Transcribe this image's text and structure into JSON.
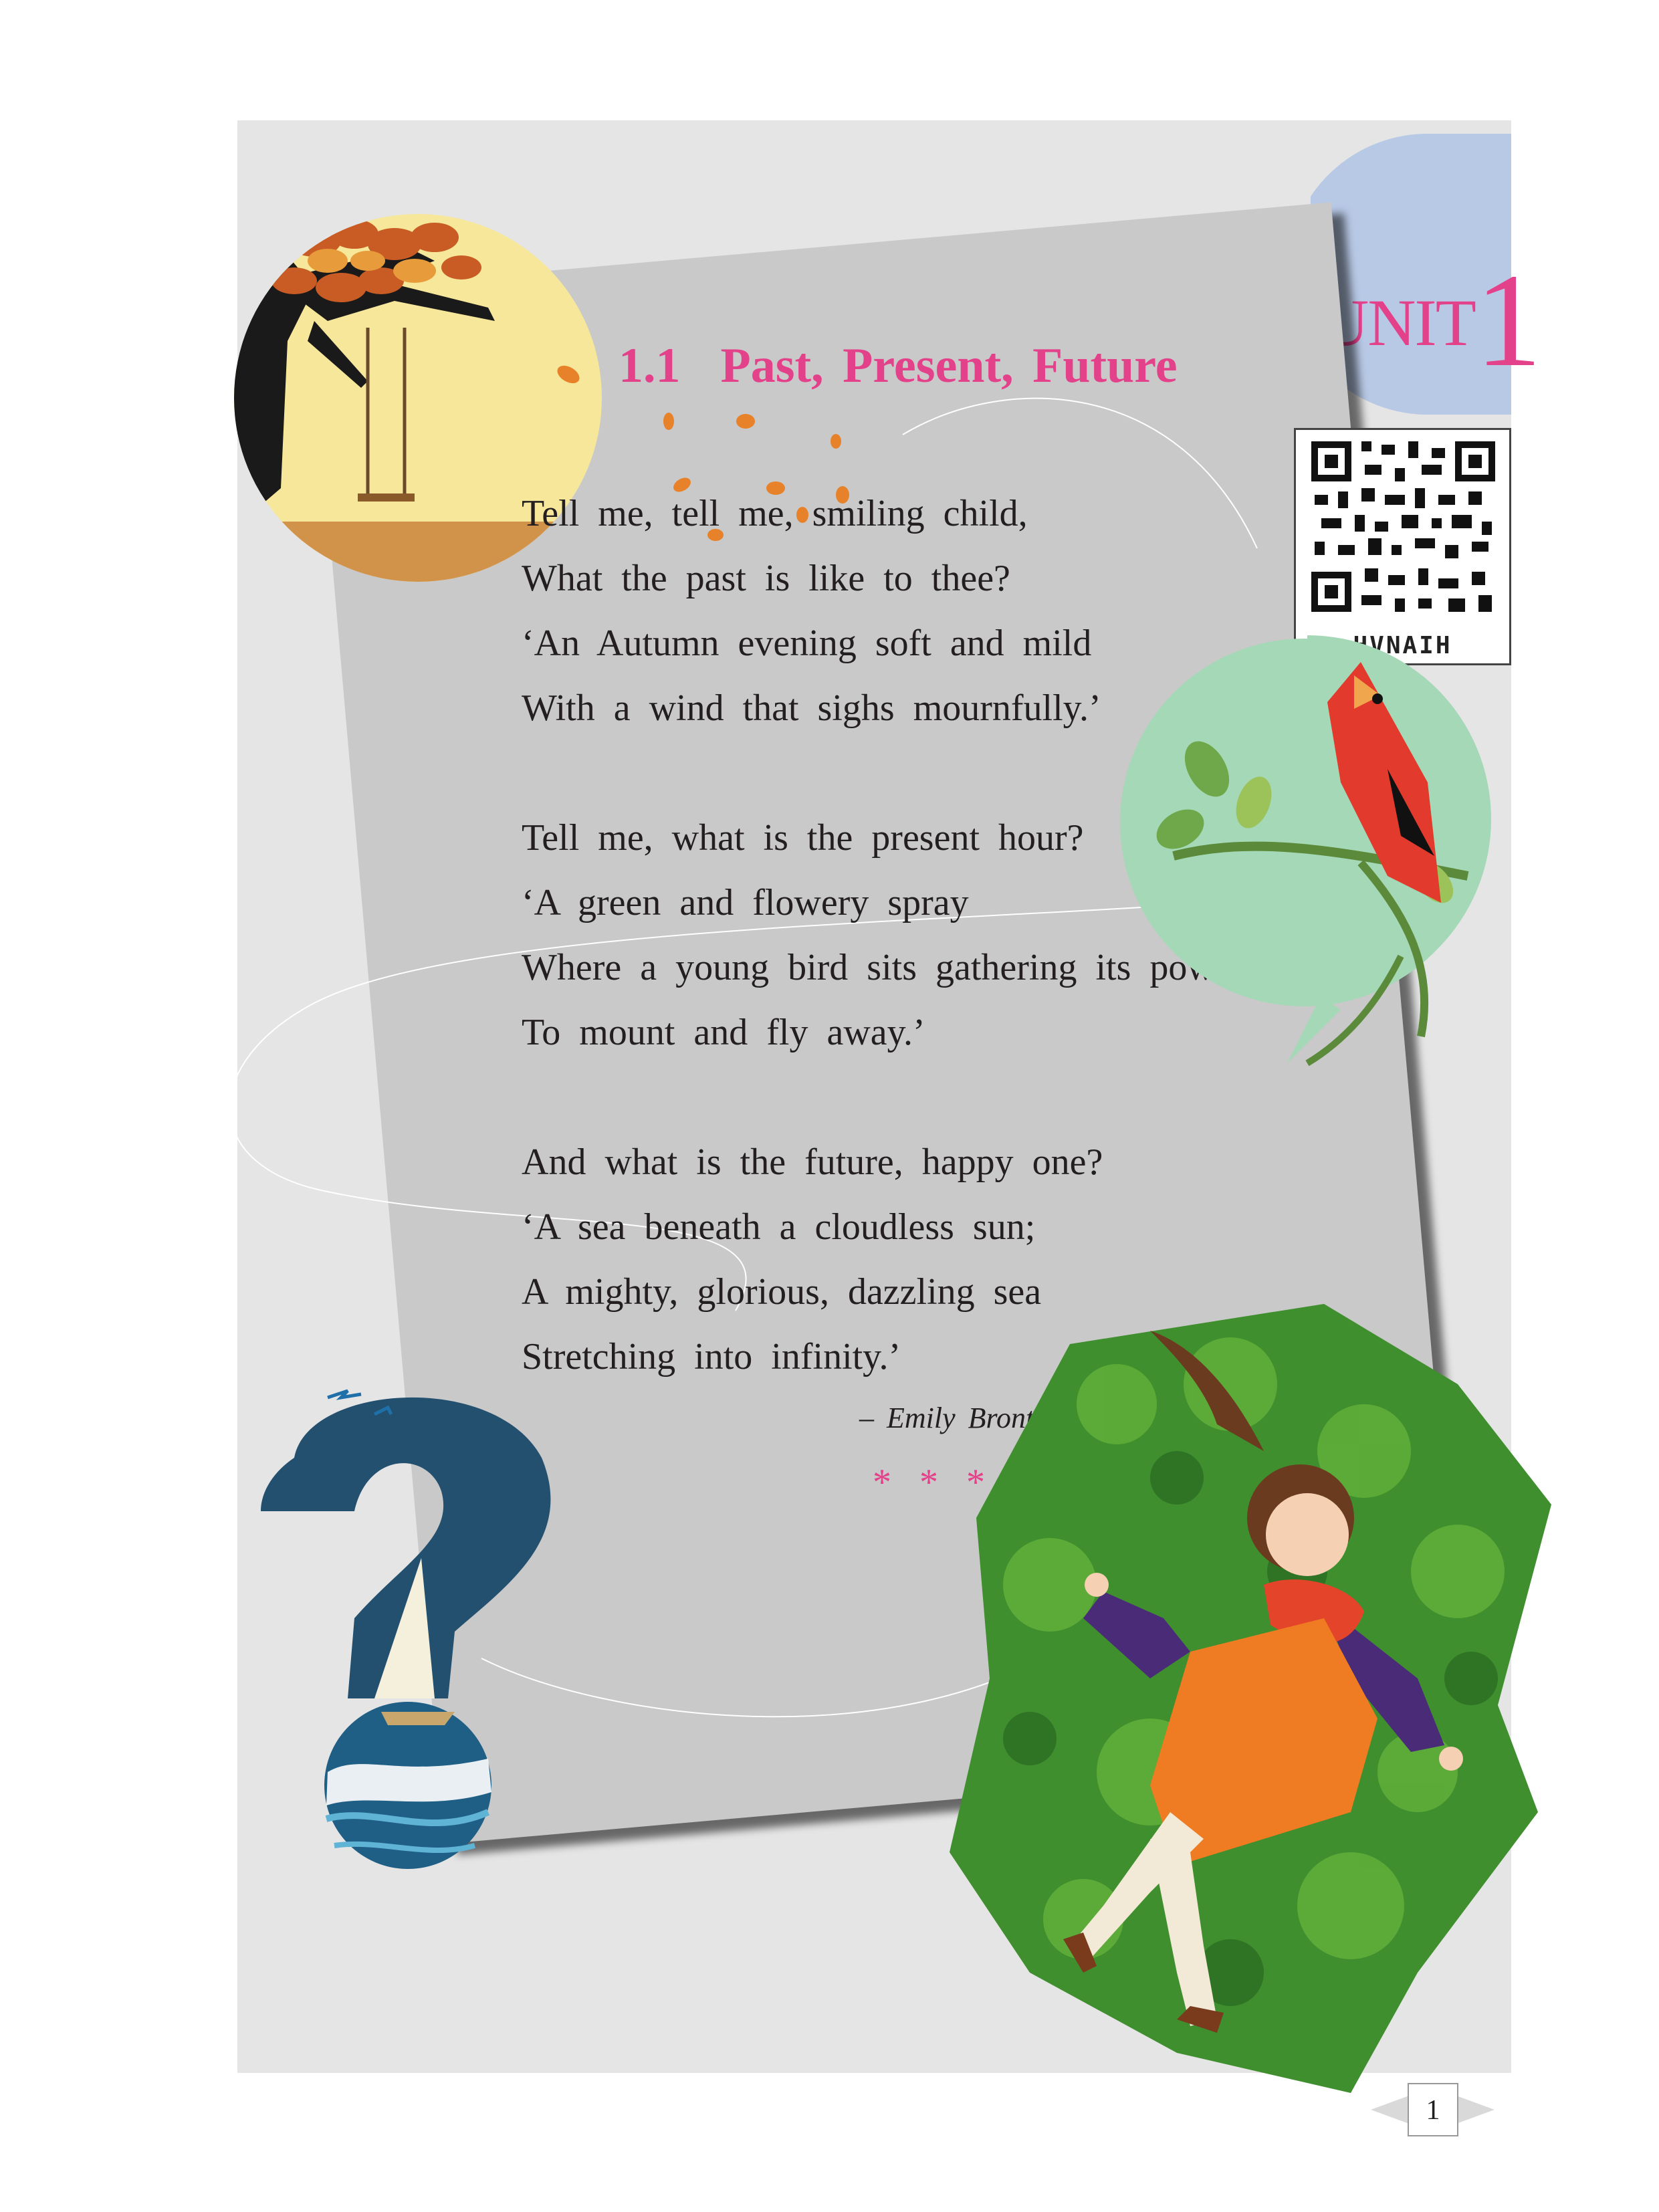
{
  "unit": {
    "prefix": "UNIT",
    "number": "1"
  },
  "title": {
    "number": "1.1",
    "text": "Past, Present, Future"
  },
  "poem": {
    "stanzas": [
      [
        "Tell me, tell me, smiling child,",
        "What the past is like to thee?",
        "‘An Autumn evening soft and mild",
        "With a wind that sighs mournfully.’"
      ],
      [
        "Tell me, what is the present hour?",
        "‘A green and flowery spray",
        "Where a young bird sits gathering its power",
        "To mount and fly away.’"
      ],
      [
        "And what is the future, happy one?",
        "‘A sea beneath a cloudless sun;",
        "A mighty, glorious, dazzling sea",
        "Stretching into infinity.’"
      ]
    ],
    "author": "– Emily Bronte",
    "separator": "* * *"
  },
  "qr": {
    "caption": "HVNAIH"
  },
  "page_number": "1",
  "colors": {
    "accent": "#e4418b",
    "panel": "#e6e5e6",
    "card": "#c9c9c9",
    "unit_tab": "#b8c9e6",
    "bird_bg": "#a5d8b6"
  },
  "illustrations": [
    "autumn-tree-swing",
    "cardinal-bird",
    "question-mark-sea",
    "girl-on-grass"
  ]
}
